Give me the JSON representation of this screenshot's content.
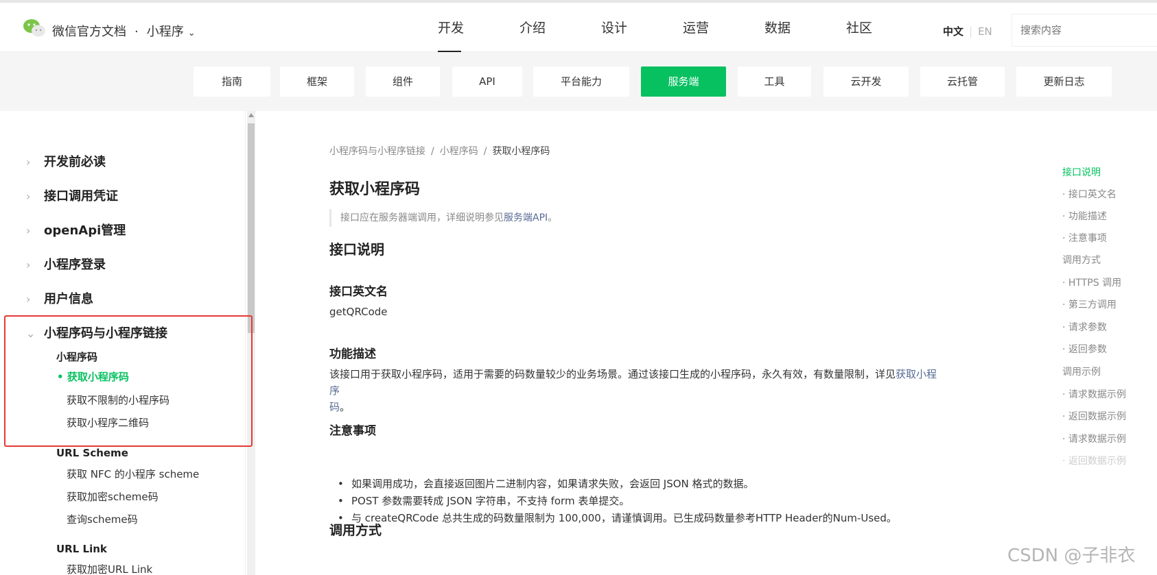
{
  "header": {
    "brand": "微信官方文档",
    "separator": "·",
    "product": "小程序",
    "nav": [
      "开发",
      "介绍",
      "设计",
      "运营",
      "数据",
      "社区"
    ],
    "nav_active": "开发",
    "lang_zh": "中文",
    "lang_sep": "|",
    "lang_en": "EN",
    "search_placeholder": "搜索内容"
  },
  "categories": [
    "指南",
    "框架",
    "组件",
    "API",
    "平台能力",
    "服务端",
    "工具",
    "云开发",
    "云托管",
    "更新日志"
  ],
  "category_active": "服务端",
  "sidebar": {
    "sections": [
      "开发前必读",
      "接口调用凭证",
      "openApi管理",
      "小程序登录",
      "用户信息",
      "小程序码与小程序链接"
    ],
    "groups": [
      "小程序码",
      "URL Scheme",
      "URL Link"
    ],
    "leaves": {
      "qrcode": [
        "获取小程序码",
        "获取不限制的小程序码",
        "获取小程序二维码"
      ],
      "scheme": [
        "获取 NFC 的小程序 scheme",
        "获取加密scheme码",
        "查询scheme码"
      ],
      "link": [
        "获取加密URL Link"
      ]
    }
  },
  "content": {
    "breadcrumb": [
      "小程序码与小程序链接",
      "小程序码",
      "获取小程序码"
    ],
    "title": "获取小程序码",
    "notice_text": "接口应在服务器端调用，详细说明参见",
    "notice_link": "服务端API",
    "notice_end": "。",
    "h_desc": "接口说明",
    "h_en_name": "接口英文名",
    "en_name": "getQRCode",
    "h_func": "功能描述",
    "func_text_1": "该接口用于获取小程序码，适用于需要的码数量较少的业务场景。通过该接口生成的小程序码，永久有效，有数量限制，详见",
    "func_link_1": "获取小程序",
    "func_link_2": "码",
    "func_end": "。",
    "h_notes": "注意事项",
    "notes": [
      "如果调用成功，会直接返回图片二进制内容，如果请求失败，会返回 JSON 格式的数据。",
      "POST 参数需要转成 JSON 字符串，不支持 form 表单提交。",
      "与 createQRCode 总共生成的码数量限制为 100,000，请谨慎调用。已生成码数量参考HTTP Header的Num-Used。"
    ],
    "h_call": "调用方式"
  },
  "toc": [
    "接口说明",
    "· 接口英文名",
    "· 功能描述",
    "· 注意事项",
    "调用方式",
    "· HTTPS 调用",
    "· 第三方调用",
    "· 请求参数",
    "· 返回参数",
    "调用示例",
    "· 请求数据示例",
    "· 返回数据示例",
    "· 请求数据示例",
    "· 返回数据示例"
  ],
  "toc_active": "接口说明",
  "watermark": "CSDN @子非衣",
  "colors": {
    "accent": "#07c160",
    "link": "#576b95",
    "highlight_box": "#e53935"
  }
}
